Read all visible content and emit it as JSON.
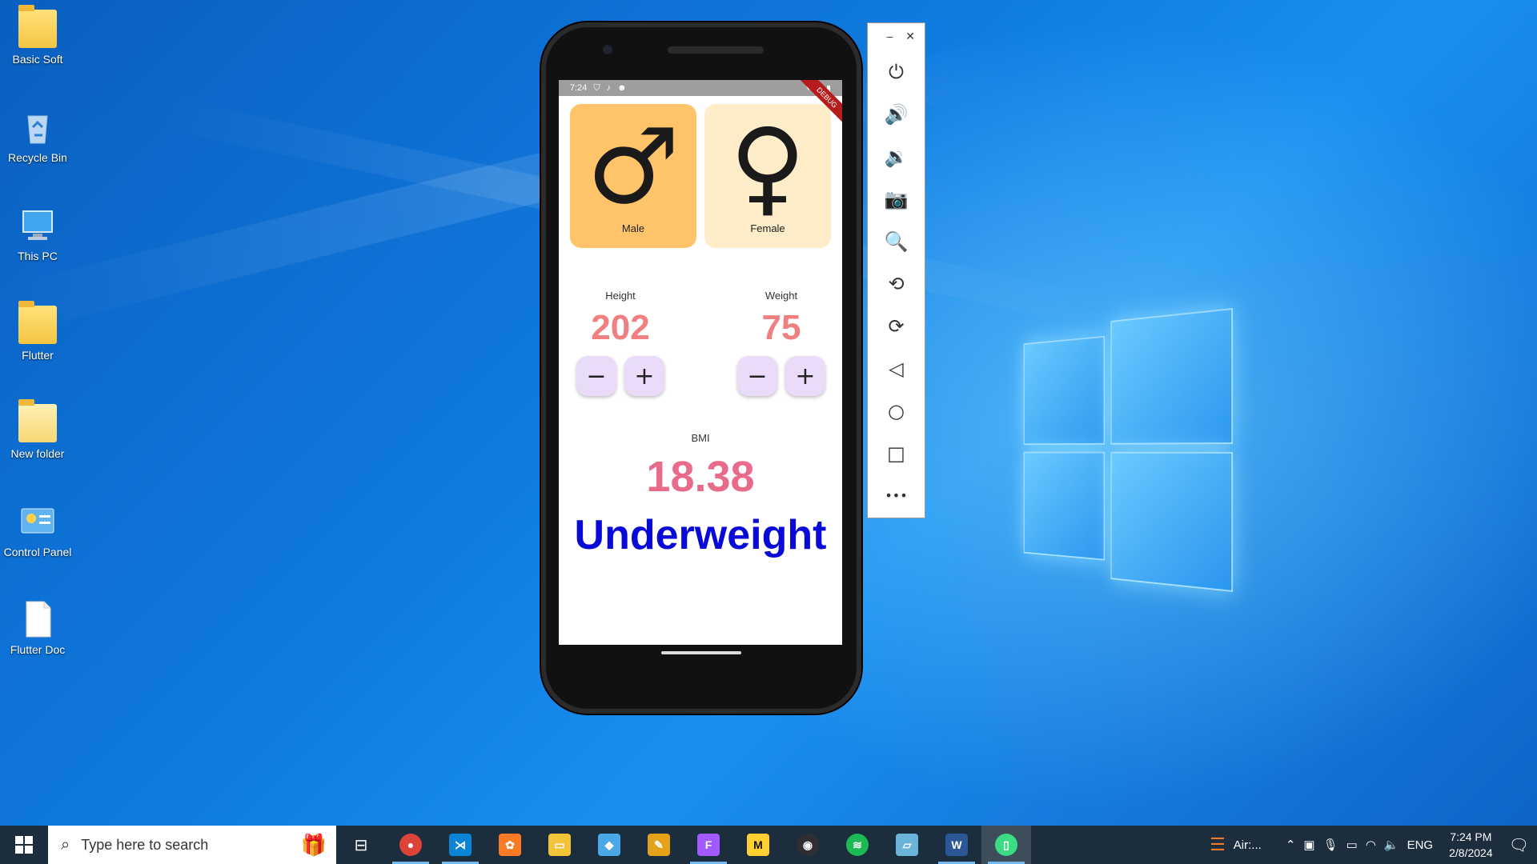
{
  "desktop": {
    "icons": [
      {
        "label": "Basic Soft",
        "icon": "folder-icon"
      },
      {
        "label": "Recycle Bin",
        "icon": "recycle-bin-icon"
      },
      {
        "label": "This PC",
        "icon": "computer-icon"
      },
      {
        "label": "Flutter",
        "icon": "folder-icon"
      },
      {
        "label": "New folder",
        "icon": "folder-icon"
      },
      {
        "label": "Control Panel",
        "icon": "control-panel-icon"
      },
      {
        "label": "Flutter Doc",
        "icon": "document-icon"
      }
    ]
  },
  "phone": {
    "status_time": "7:24",
    "debug_banner": "DEBUG",
    "gender": {
      "male_label": "Male",
      "female_label": "Female",
      "male_symbol": "♂",
      "female_symbol": "♀",
      "selected": "Male"
    },
    "height": {
      "label": "Height",
      "value": "202",
      "minus": "−",
      "plus": "+"
    },
    "weight": {
      "label": "Weight",
      "value": "75",
      "minus": "−",
      "plus": "+"
    },
    "bmi": {
      "label": "BMI",
      "value": "18.38",
      "status": "Underweight"
    }
  },
  "emulator_toolbar": {
    "minimize": "–",
    "close": "✕",
    "buttons": [
      {
        "name": "power-icon",
        "glyph": "⏻"
      },
      {
        "name": "volume-up-icon",
        "glyph": "🔊"
      },
      {
        "name": "volume-down-icon",
        "glyph": "🔉"
      },
      {
        "name": "camera-icon",
        "glyph": "📷"
      },
      {
        "name": "zoom-icon",
        "glyph": "🔍"
      },
      {
        "name": "rotate-left-icon",
        "glyph": "⟲"
      },
      {
        "name": "rotate-right-icon",
        "glyph": "⟳"
      },
      {
        "name": "back-icon",
        "glyph": "◁"
      },
      {
        "name": "home-icon",
        "glyph": "○"
      },
      {
        "name": "overview-icon",
        "glyph": "□"
      },
      {
        "name": "more-icon",
        "glyph": "•••"
      }
    ]
  },
  "taskbar": {
    "search_placeholder": "Type here to search",
    "apps": [
      {
        "name": "chrome",
        "glyph": "●",
        "color": "#db4437"
      },
      {
        "name": "vscode",
        "glyph": "⋊",
        "color": "#0a84d6"
      },
      {
        "name": "xampp",
        "glyph": "✿",
        "color": "#fb7a24"
      },
      {
        "name": "file-explorer",
        "glyph": "▭",
        "color": "#f3c33a"
      },
      {
        "name": "cube-app",
        "glyph": "◆",
        "color": "#4aa8e8"
      },
      {
        "name": "tools-app",
        "glyph": "✎",
        "color": "#e3a21a"
      },
      {
        "name": "figma",
        "glyph": "F",
        "color": "#a259ff"
      },
      {
        "name": "miro",
        "glyph": "M",
        "color": "#ffd02f"
      },
      {
        "name": "obs",
        "glyph": "◉",
        "color": "#302e31"
      },
      {
        "name": "spotify",
        "glyph": "≋",
        "color": "#1db954"
      },
      {
        "name": "notepad",
        "glyph": "▱",
        "color": "#6ab4d9"
      },
      {
        "name": "word",
        "glyph": "W",
        "color": "#2b5797"
      },
      {
        "name": "android-emulator",
        "glyph": "▯",
        "color": "#3ddc84"
      }
    ],
    "weather_label": "Air:...",
    "language": "ENG",
    "time": "7:24 PM",
    "date": "2/8/2024"
  }
}
